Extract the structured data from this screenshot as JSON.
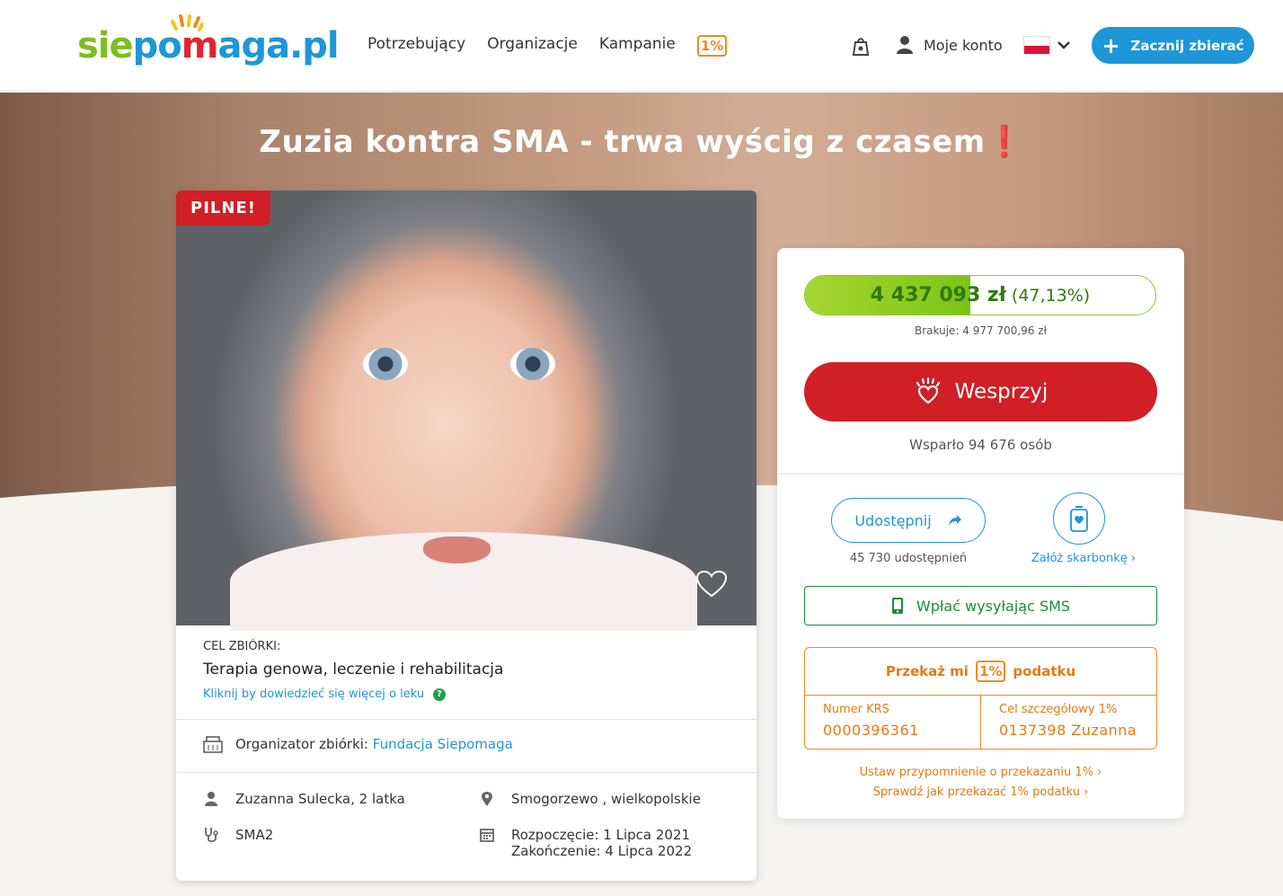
{
  "header": {
    "logo_parts": [
      "sie",
      "po",
      "m",
      "aga.pl"
    ],
    "nav": [
      "Potrzebujący",
      "Organizacje",
      "Kampanie"
    ],
    "onepct_label": "1%",
    "account_label": "Moje konto",
    "start_button": "Zacznij zbierać"
  },
  "campaign": {
    "title": "Zuzia kontra SMA - trwa wyścig z czasem",
    "title_suffix": "❗",
    "badge": "PILNE!",
    "goal_label": "CEL ZBIÓRKI:",
    "goal_text": "Terapia genowa, leczenie i rehabilitacja",
    "goal_link": "Kliknij by dowiedzieć się więcej o leku",
    "goal_help": "?",
    "organizer_label": "Organizator zbiórki:",
    "organizer_name": "Fundacja Siepomaga",
    "beneficiary": "Zuzanna Sulecka, 2 latka",
    "location": "Smogorzewo , wielkopolskie",
    "disease": "SMA2",
    "start_date": "Rozpoczęcie: 1 Lipca 2021",
    "end_date": "Zakończenie: 4 Lipca 2022"
  },
  "donation": {
    "amount": "4 437 093 zł",
    "percent_label": "(47,13%)",
    "progress_fraction": 0.4713,
    "missing": "Brakuje: 4 977 700,96 zł",
    "support_button": "Wesprzyj",
    "supporters": "Wsparło 94 676 osób",
    "share_button": "Udostępnij",
    "share_count": "45 730 udostępnień",
    "piggy_link": "Załóż skarbonkę",
    "sms_button": "Wpłać wysyłając SMS",
    "tax_head_pre": "Przekaż mi",
    "tax_head_post": "podatku",
    "krs_label": "Numer KRS",
    "krs_value": "0000396361",
    "goal1_label": "Cel szczegółowy 1%",
    "goal1_value": "0137398 Zuzanna",
    "reminder_link": "Ustaw przypomnienie o przekazaniu 1%",
    "howto_link": "Sprawdź jak przekazać 1% podatku"
  },
  "colors": {
    "brand_blue": "#1e96d8",
    "brand_red": "#d01f26",
    "brand_green": "#7cbf1f",
    "tax_orange": "#f08a1c"
  }
}
